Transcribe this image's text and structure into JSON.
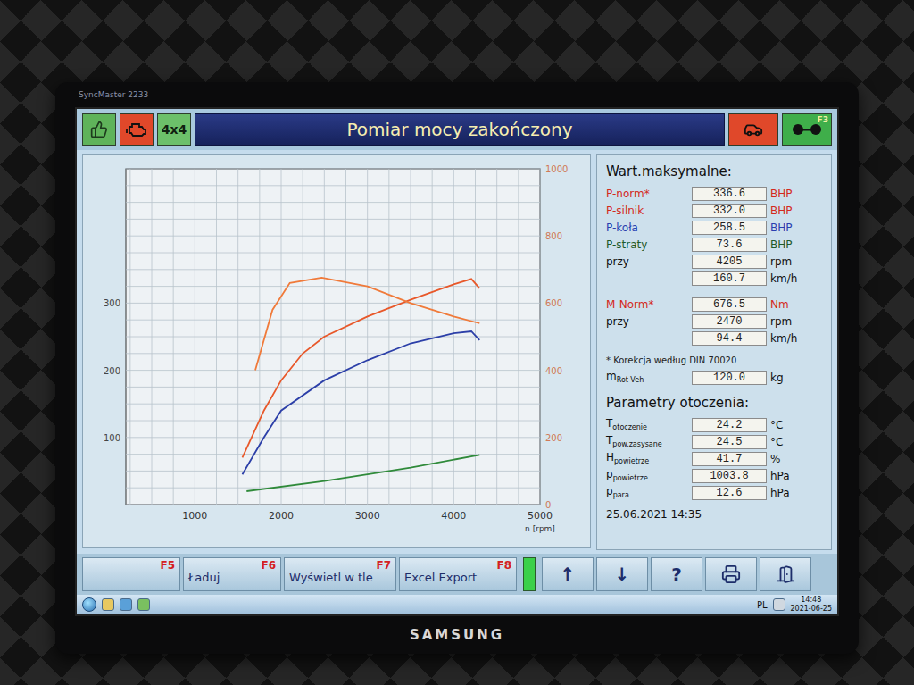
{
  "monitor": {
    "model": "SyncMaster 2233",
    "brand": "SAMSUNG"
  },
  "header": {
    "title": "Pomiar mocy zakończony",
    "left_buttons": [
      {
        "kind": "thumb",
        "color": "#5fb35a"
      },
      {
        "kind": "engine",
        "color": "#e0482a"
      },
      {
        "kind": "text",
        "label": "4x4",
        "color": "#6cc06a"
      }
    ],
    "right_buttons": [
      {
        "kind": "car",
        "color": "#e0482a"
      },
      {
        "kind": "axle",
        "key": "F3",
        "color": "#3fae4a"
      }
    ]
  },
  "chart": {
    "x_axis": {
      "min": 200,
      "max": 5000,
      "ticks": [
        "1000",
        "2000",
        "3000",
        "4000",
        "5000"
      ],
      "label": "n [rpm]"
    },
    "y_left": {
      "min": 0,
      "max": 500,
      "ticks": [
        "100",
        "200",
        "300"
      ]
    },
    "y_right": {
      "min": 0,
      "max": 1000,
      "ticks": [
        "0",
        "200",
        "400",
        "600",
        "800",
        "1000"
      ]
    },
    "series": [
      {
        "axis": "left",
        "color": "#e8582a",
        "rpm": [
          1550,
          1800,
          2000,
          2250,
          2500,
          3000,
          3500,
          4000,
          4205,
          4300
        ],
        "values": [
          70,
          140,
          185,
          225,
          250,
          280,
          305,
          328,
          336,
          322
        ]
      },
      {
        "axis": "right",
        "color": "#f07a3a",
        "rpm": [
          1700,
          1900,
          2100,
          2470,
          3000,
          3500,
          4000,
          4300
        ],
        "values": [
          400,
          580,
          660,
          676,
          650,
          600,
          560,
          540
        ]
      },
      {
        "axis": "left",
        "color": "#2c3fa8",
        "rpm": [
          1550,
          1800,
          2000,
          2500,
          3000,
          3500,
          4000,
          4205,
          4300
        ],
        "values": [
          45,
          100,
          140,
          185,
          215,
          240,
          255,
          258,
          245
        ]
      },
      {
        "axis": "left",
        "color": "#2f8a3a",
        "rpm": [
          1600,
          2500,
          3500,
          4300
        ],
        "values": [
          20,
          35,
          55,
          74
        ]
      }
    ]
  },
  "max_values": {
    "title": "Wart.maksymalne:",
    "groups": [
      {
        "rows": [
          {
            "label": "P-norm*",
            "value": "336.6",
            "unit": "BHP",
            "color": "#d42a1e"
          },
          {
            "label": "P-silnik",
            "value": "332.0",
            "unit": "BHP",
            "color": "#d42a1e"
          },
          {
            "label": "P-koła",
            "value": "258.5",
            "unit": "BHP",
            "color": "#2a3fb0"
          },
          {
            "label": "P-straty",
            "value": "73.6",
            "unit": "BHP",
            "color": "#1e5a2a"
          },
          {
            "label": "przy",
            "value": "4205",
            "unit": "rpm",
            "color": "#111111"
          },
          {
            "label": "",
            "value": "160.7",
            "unit": "km/h",
            "color": "#111111"
          }
        ]
      },
      {
        "rows": [
          {
            "label": "M-Norm*",
            "value": "676.5",
            "unit": "Nm",
            "color": "#d42a1e"
          },
          {
            "label": "przy",
            "value": "2470",
            "unit": "rpm",
            "color": "#111111"
          },
          {
            "label": "",
            "value": "94.4",
            "unit": "km/h",
            "color": "#111111"
          }
        ]
      }
    ],
    "note": "* Korekcja według DIN 70020",
    "extra_rows": [
      {
        "label": "m",
        "sub": "Rot-Veh",
        "value": "120.0",
        "unit": "kg",
        "color": "#111111"
      }
    ]
  },
  "ambient": {
    "title": "Parametry otoczenia:",
    "rows": [
      {
        "label": "T",
        "sub": "otoczenie",
        "value": "24.2",
        "unit": "°C",
        "color": "#111111"
      },
      {
        "label": "T",
        "sub": "pow.zasysane",
        "value": "24.5",
        "unit": "°C",
        "color": "#111111"
      },
      {
        "label": "H",
        "sub": "powietrze",
        "value": "41.7",
        "unit": "%",
        "color": "#111111"
      },
      {
        "label": "p",
        "sub": "powietrze",
        "value": "1003.8",
        "unit": "hPa",
        "color": "#111111"
      },
      {
        "label": "p",
        "sub": "para",
        "value": "12.6",
        "unit": "hPa",
        "color": "#111111"
      }
    ]
  },
  "timestamp": "25.06.2021  14:35",
  "toolbar": {
    "buttons": [
      {
        "label": "",
        "key": "F5"
      },
      {
        "label": "Ładuj",
        "key": "F6"
      },
      {
        "label": "Wyświetl w tle",
        "key": "F7"
      },
      {
        "label": "Excel Export",
        "key": "F8"
      }
    ],
    "indicator": {
      "on": true
    },
    "icons": [
      {
        "kind": "glyph",
        "label": "↑"
      },
      {
        "kind": "glyph",
        "label": "↓"
      },
      {
        "kind": "glyph",
        "label": "?"
      },
      {
        "kind": "printer"
      },
      {
        "kind": "door"
      }
    ]
  },
  "taskbar": {
    "language": "PL",
    "time": "14:48",
    "date": "2021-06-25"
  }
}
